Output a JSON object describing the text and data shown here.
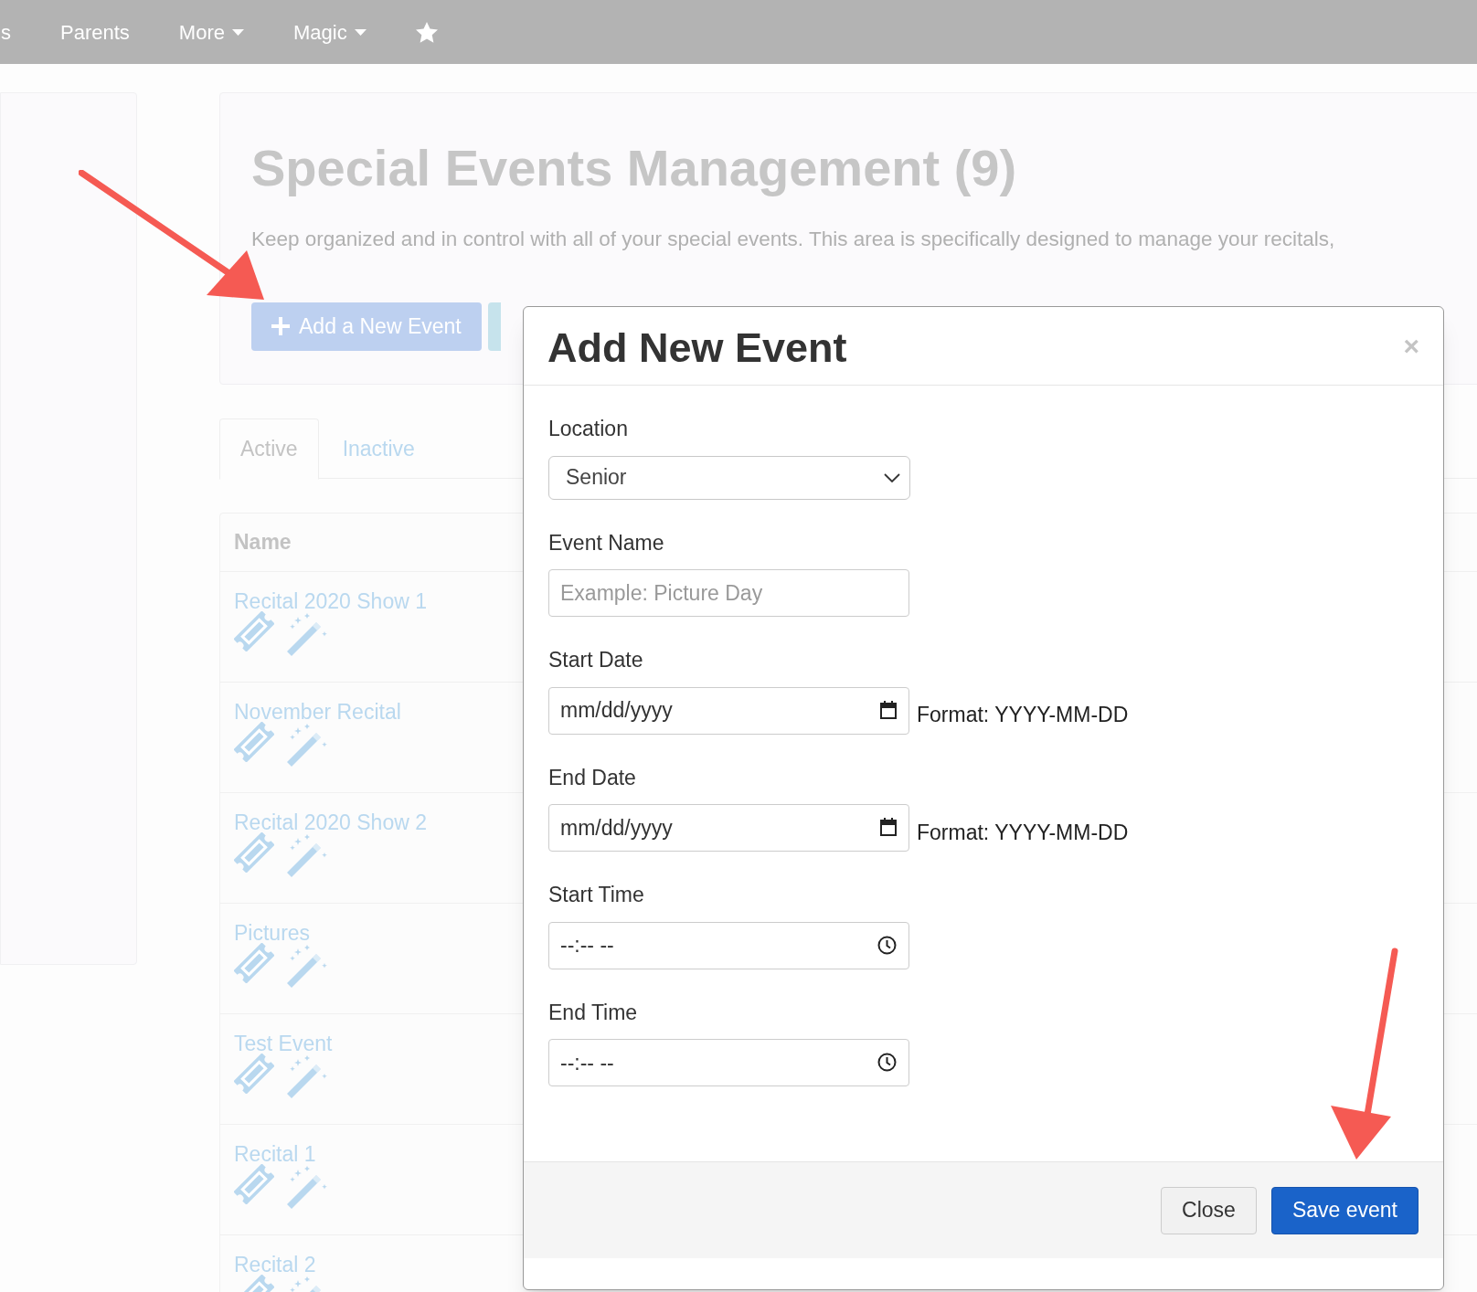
{
  "nav": {
    "items": [
      {
        "label": "s",
        "caret": false
      },
      {
        "label": "Parents",
        "caret": false
      },
      {
        "label": "More",
        "caret": true
      },
      {
        "label": "Magic",
        "caret": true
      }
    ]
  },
  "header": {
    "title": "Special Events Management (9)",
    "description": "Keep organized and in control with all of your special events. This area is specifically designed to manage your recitals,",
    "add_button": "Add a New Event"
  },
  "tabs": [
    {
      "label": "Active",
      "selected": true
    },
    {
      "label": "Inactive",
      "selected": false
    }
  ],
  "table": {
    "columns": [
      "Name"
    ],
    "rows": [
      {
        "name": "Recital 2020 Show 1"
      },
      {
        "name": "November Recital"
      },
      {
        "name": "Recital 2020 Show 2"
      },
      {
        "name": "Pictures"
      },
      {
        "name": "Test Event"
      },
      {
        "name": "Recital 1"
      },
      {
        "name": "Recital 2"
      }
    ]
  },
  "modal": {
    "title": "Add New Event",
    "close": "×",
    "fields": [
      {
        "label": "Location",
        "kind": "select",
        "value": "Senior"
      },
      {
        "label": "Event Name",
        "kind": "text",
        "placeholder": "Example: Picture Day"
      },
      {
        "label": "Start Date",
        "kind": "date",
        "placeholder": "mm/dd/yyyy",
        "hint": "Format: YYYY-MM-DD"
      },
      {
        "label": "End Date",
        "kind": "date",
        "placeholder": "mm/dd/yyyy",
        "hint": "Format: YYYY-MM-DD"
      },
      {
        "label": "Start Time",
        "kind": "time",
        "placeholder": "--:-- --"
      },
      {
        "label": "End Time",
        "kind": "time",
        "placeholder": "--:-- --"
      }
    ],
    "buttons": [
      {
        "label": "Close",
        "kind": "secondary"
      },
      {
        "label": "Save event",
        "kind": "primary"
      }
    ]
  }
}
